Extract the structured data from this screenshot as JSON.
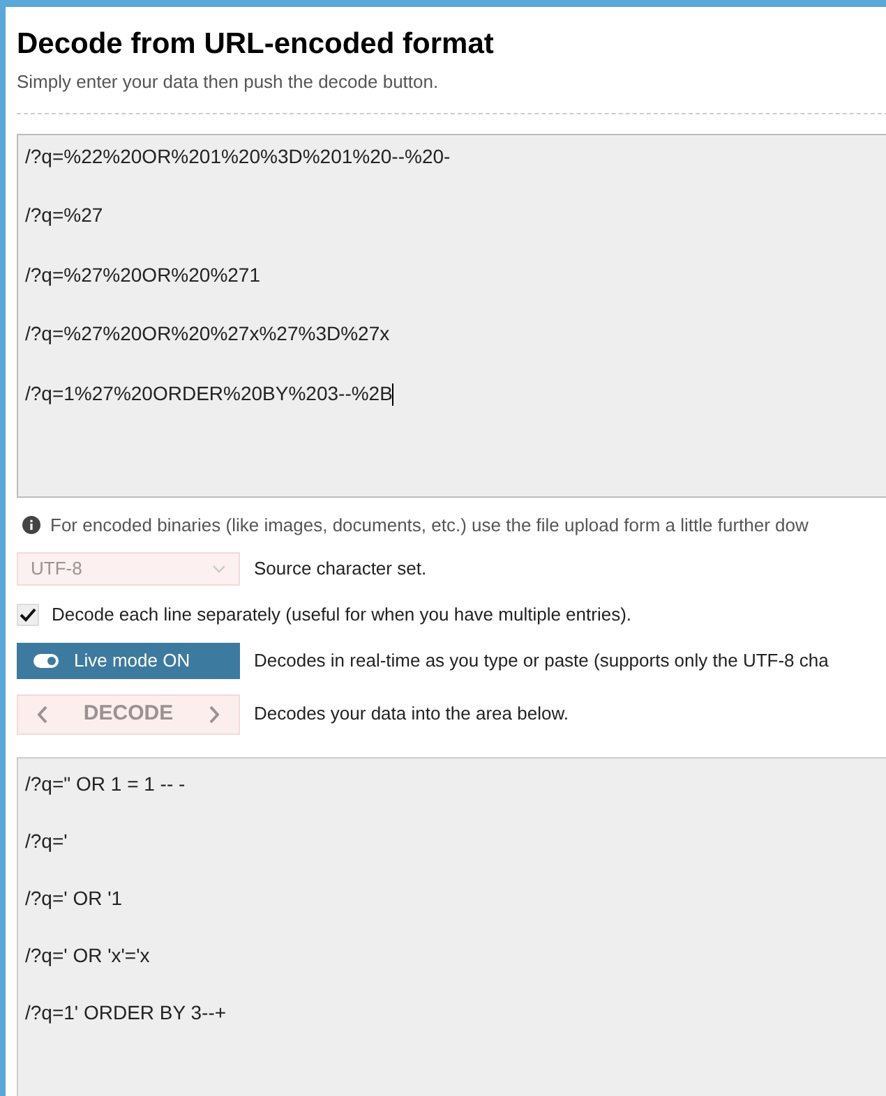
{
  "title": "Decode from URL-encoded format",
  "subtitle": "Simply enter your data then push the decode button.",
  "input": {
    "lines": [
      "/?q=%22%20OR%201%20%3D%201%20--%20-",
      "/?q=%27",
      "/?q=%27%20OR%20%271",
      "/?q=%27%20OR%20%27x%27%3D%27x",
      "/?q=1%27%20ORDER%20BY%203--%2B"
    ]
  },
  "info_note": "For encoded binaries (like images, documents, etc.) use the file upload form a little further dow",
  "charset": {
    "value": "UTF-8",
    "disabled": true,
    "label": "Source character set."
  },
  "line_option": {
    "label": "Decode each line separately (useful for when you have multiple entries).",
    "checked": true
  },
  "live_mode": {
    "label": "Live mode ON",
    "on": true,
    "description": "Decodes in real-time as you type or paste (supports only the UTF-8 cha"
  },
  "decode_button": {
    "label": "DECODE",
    "disabled": true,
    "description": "Decodes your data into the area below."
  },
  "output": {
    "lines": [
      "/?q=\" OR 1 = 1 -- -",
      "/?q='",
      "/?q=' OR '1",
      "/?q=' OR 'x'='x",
      "/?q=1' ORDER BY 3--+"
    ]
  }
}
